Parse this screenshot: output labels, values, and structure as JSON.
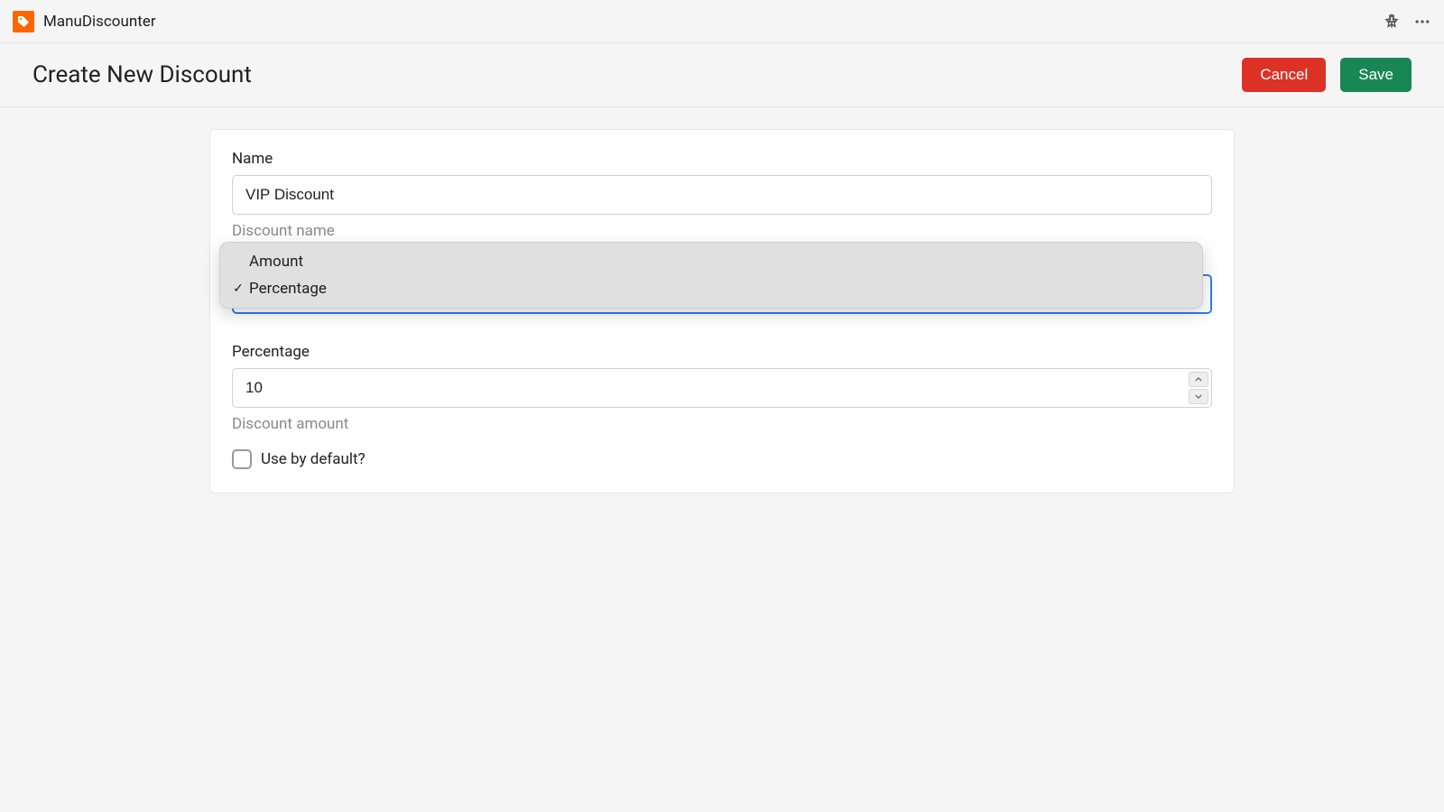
{
  "app": {
    "name": "ManuDiscounter"
  },
  "page": {
    "title": "Create New Discount",
    "cancel_label": "Cancel",
    "save_label": "Save"
  },
  "form": {
    "name": {
      "label": "Name",
      "value": "VIP Discount",
      "help": "Discount name"
    },
    "type": {
      "options": [
        "Amount",
        "Percentage"
      ],
      "selected": "Percentage"
    },
    "percentage": {
      "label": "Percentage",
      "value": "10",
      "help": "Discount amount"
    },
    "use_default": {
      "label": "Use by default?",
      "checked": false
    }
  }
}
